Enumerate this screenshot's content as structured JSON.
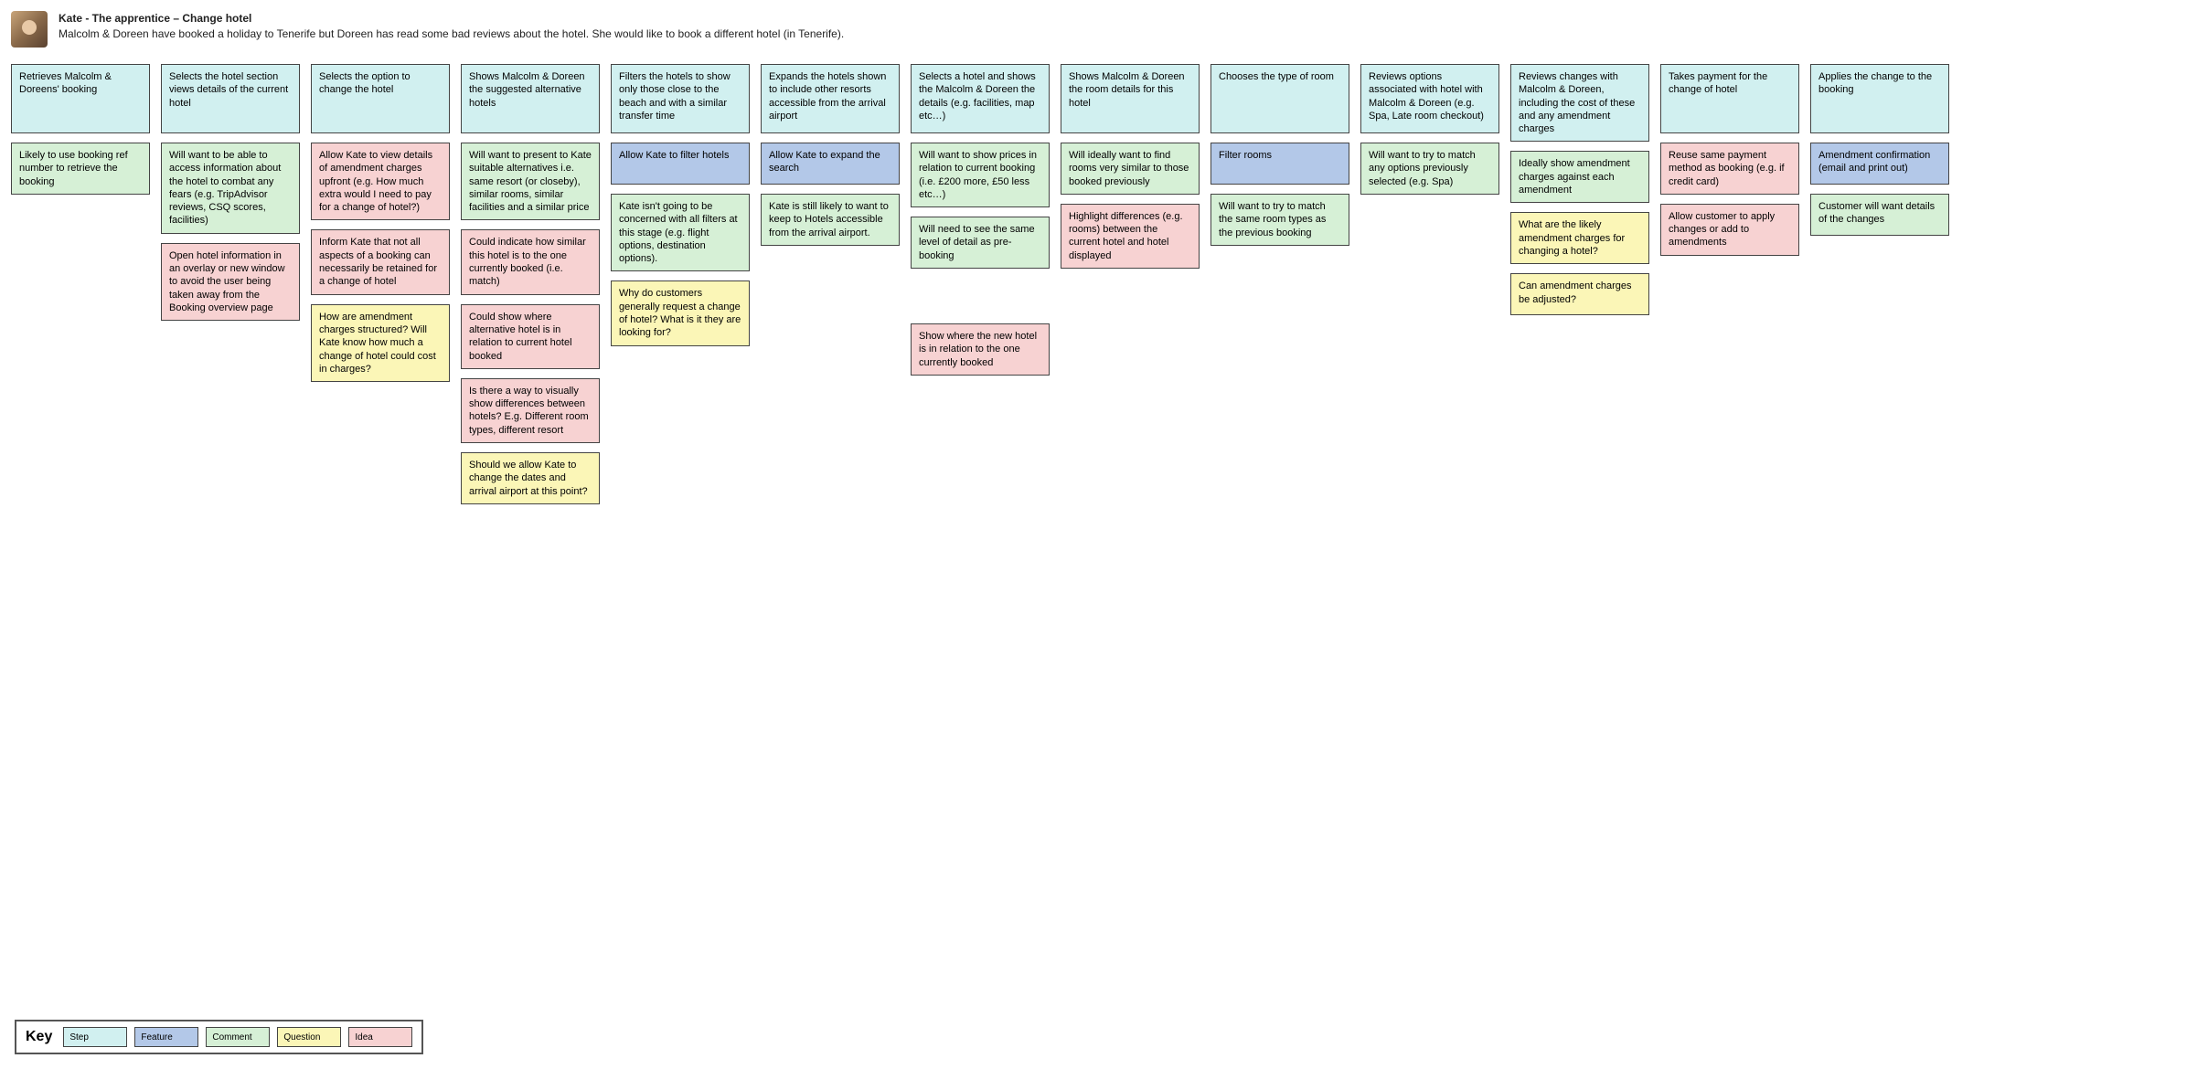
{
  "header": {
    "title": "Kate - The apprentice – Change hotel",
    "subtitle": "Malcolm & Doreen have booked a holiday to Tenerife but Doreen has read some bad reviews about the hotel. She would like to book a different hotel (in Tenerife)."
  },
  "key": {
    "label": "Key",
    "items": [
      {
        "label": "Step",
        "type": "step"
      },
      {
        "label": "Feature",
        "type": "feature"
      },
      {
        "label": "Comment",
        "type": "comment"
      },
      {
        "label": "Question",
        "type": "question"
      },
      {
        "label": "Idea",
        "type": "idea"
      }
    ]
  },
  "columns": [
    {
      "step": "Retrieves Malcolm & Doreens' booking",
      "cards": [
        {
          "type": "comment",
          "text": "Likely to use booking ref number to retrieve the booking"
        }
      ]
    },
    {
      "step": "Selects the hotel section views details of the current hotel",
      "cards": [
        {
          "type": "comment",
          "text": "Will want to be able to access information about the hotel to combat any fears (e.g. TripAdvisor reviews, CSQ scores, facilities)"
        },
        {
          "type": "idea",
          "text": "Open hotel information in an overlay or new window to avoid the user being taken away from the Booking overview page"
        }
      ]
    },
    {
      "step": "Selects the option to change the hotel",
      "cards": [
        {
          "type": "idea",
          "text": "Allow Kate to view details of amendment charges upfront (e.g. How much extra would I need to pay for a change of hotel?)"
        },
        {
          "type": "idea",
          "text": "Inform Kate that not all aspects of a booking can necessarily be retained for a change of hotel"
        },
        {
          "type": "question",
          "text": "How are amendment charges structured? Will Kate know how much a change of hotel could cost in charges?"
        }
      ]
    },
    {
      "step": "Shows Malcolm & Doreen the suggested alternative hotels",
      "cards": [
        {
          "type": "comment",
          "text": "Will want to present to Kate suitable alternatives i.e. same resort (or closeby), similar rooms, similar facilities and a similar price"
        },
        {
          "type": "idea",
          "text": "Could indicate how similar this hotel is to the one currently booked (i.e. match)"
        },
        {
          "type": "idea",
          "text": "Could show where alternative hotel is in relation to current hotel booked"
        },
        {
          "type": "idea",
          "text": "Is there a way to visually show differences between hotels? E.g. Different room types, different resort"
        },
        {
          "type": "question",
          "text": "Should we allow Kate to change the dates and arrival airport at this point?"
        }
      ]
    },
    {
      "step": "Filters the hotels to show only those close to the beach and with a similar transfer time",
      "cards": [
        {
          "type": "feature",
          "text": "Allow Kate to filter hotels"
        },
        {
          "type": "comment",
          "text": "Kate isn't going to be concerned with all filters at this stage (e.g. flight options, destination options)."
        },
        {
          "type": "question",
          "text": "Why do customers generally request a change of hotel? What is it they are looking for?"
        }
      ]
    },
    {
      "step": "Expands the hotels shown to include other resorts accessible from the arrival airport",
      "cards": [
        {
          "type": "feature",
          "text": "Allow Kate to expand the search"
        },
        {
          "type": "comment",
          "text": "Kate is still likely to want to keep to Hotels accessible from the arrival airport."
        }
      ]
    },
    {
      "step": "Selects a hotel and shows the Malcolm & Doreen the details (e.g. facilities, map etc…)",
      "cards": [
        {
          "type": "comment",
          "text": "Will want to show prices in relation to current booking (i.e. £200 more, £50 less etc…)"
        },
        {
          "type": "comment",
          "text": "Will need to see the same level of detail as pre-booking"
        },
        {
          "type": "idea",
          "text": "Show where the new hotel is in relation to the one currently booked"
        }
      ]
    },
    {
      "step": "Shows Malcolm & Doreen the room details for this hotel",
      "cards": [
        {
          "type": "comment",
          "text": "Will ideally want to find rooms very similar to those booked previously"
        },
        {
          "type": "idea",
          "text": "Highlight differences (e.g. rooms) between the current hotel and hotel displayed"
        }
      ]
    },
    {
      "step": "Chooses the type of room",
      "cards": [
        {
          "type": "feature",
          "text": "Filter rooms"
        },
        {
          "type": "comment",
          "text": "Will want to try to match the same room types as the previous booking"
        }
      ]
    },
    {
      "step": "Reviews options associated with hotel with Malcolm & Doreen (e.g. Spa, Late room checkout)",
      "cards": [
        {
          "type": "comment",
          "text": "Will want to try to match any options previously selected (e.g. Spa)"
        }
      ]
    },
    {
      "step": "Reviews changes with Malcolm & Doreen, including the cost of these and any amendment charges",
      "cards": [
        {
          "type": "comment",
          "text": "Ideally show amendment charges against each amendment"
        },
        {
          "type": "question",
          "text": "What are the likely amendment charges for changing a hotel?"
        },
        {
          "type": "question",
          "text": "Can amendment charges be adjusted?"
        }
      ]
    },
    {
      "step": "Takes payment for the change of hotel",
      "cards": [
        {
          "type": "idea",
          "text": "Reuse same payment method as booking (e.g. if credit card)"
        },
        {
          "type": "idea",
          "text": "Allow customer to apply changes or add to amendments"
        }
      ]
    },
    {
      "step": "Applies the change to the booking",
      "cards": [
        {
          "type": "feature",
          "text": "Amendment confirmation (email and print out)"
        },
        {
          "type": "comment",
          "text": "Customer will want details of the changes"
        }
      ]
    }
  ]
}
